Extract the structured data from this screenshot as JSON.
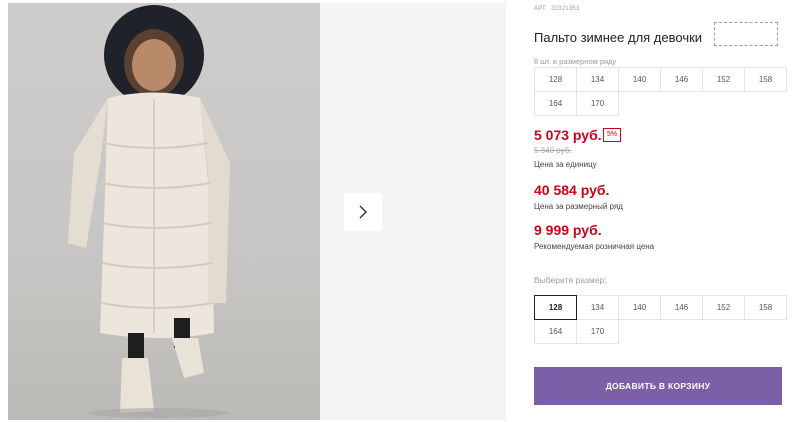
{
  "product": {
    "sku_label": "АРТ.",
    "sku_value": "32321353",
    "title": "Пальто зимнее для девочки"
  },
  "size_row": {
    "note": "8 шт. в размерном ряду",
    "sizes": [
      "128",
      "134",
      "140",
      "146",
      "152",
      "158",
      "164",
      "170"
    ]
  },
  "pricing": {
    "unit_price": "5 073 руб.",
    "discount": "5%",
    "old_price": "5 340 руб.",
    "unit_caption": "Цена за единицу",
    "row_price": "40 584 руб.",
    "row_caption": "Цена за размерный ряд",
    "rrp_price": "9 999 руб.",
    "rrp_caption": "Рекомендуемая розничная цена"
  },
  "size_select": {
    "label": "Выберите размер:",
    "sizes": [
      "128",
      "134",
      "140",
      "146",
      "152",
      "158",
      "164",
      "170"
    ],
    "selected": "128"
  },
  "actions": {
    "add_to_cart": "ДОБАВИТЬ В КОРЗИНУ"
  },
  "colors": {
    "price_red": "#d0021b",
    "button_purple": "#7b5fa7"
  }
}
